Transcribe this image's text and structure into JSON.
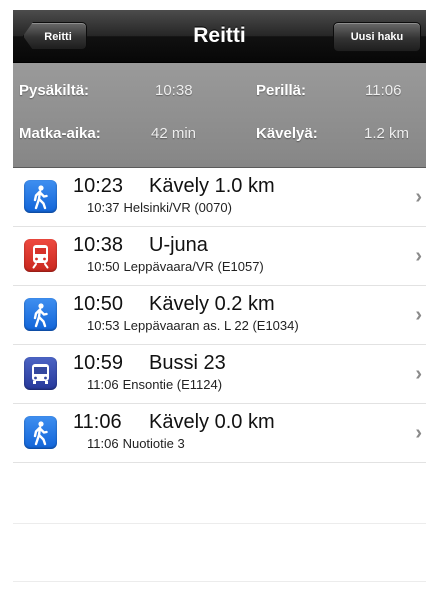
{
  "navbar": {
    "back_label": "Reitti",
    "title": "Reitti",
    "new_search_label": "Uusi haku"
  },
  "summary": {
    "departure_label": "Pysäkiltä:",
    "departure_value": "10:38",
    "arrival_label": "Perillä:",
    "arrival_value": "11:06",
    "duration_label": "Matka-aika:",
    "duration_value": "42 min",
    "walking_label": "Kävelyä:",
    "walking_value": "1.2 km"
  },
  "legs": [
    {
      "icon": "walk-icon",
      "time": "10:23",
      "mode": "Kävely 1.0 km",
      "sub_time": "10:37",
      "sub_place": "Helsinki/VR (0070)"
    },
    {
      "icon": "train-icon",
      "time": "10:38",
      "mode": "U-juna",
      "sub_time": "10:50",
      "sub_place": "Leppävaara/VR (E1057)"
    },
    {
      "icon": "walk-icon",
      "time": "10:50",
      "mode": "Kävely 0.2 km",
      "sub_time": "10:53",
      "sub_place": "Leppävaaran as. L 22 (E1034)"
    },
    {
      "icon": "bus-icon",
      "time": "10:59",
      "mode": "Bussi 23",
      "sub_time": "11:06",
      "sub_place": "Ensontie (E1124)"
    },
    {
      "icon": "walk-icon",
      "time": "11:06",
      "mode": "Kävely 0.0 km",
      "sub_time": "11:06",
      "sub_place": "Nuotiotie 3"
    }
  ],
  "colors": {
    "walk": "#1f74e6",
    "train": "#dc352c",
    "bus": "#34489f"
  }
}
